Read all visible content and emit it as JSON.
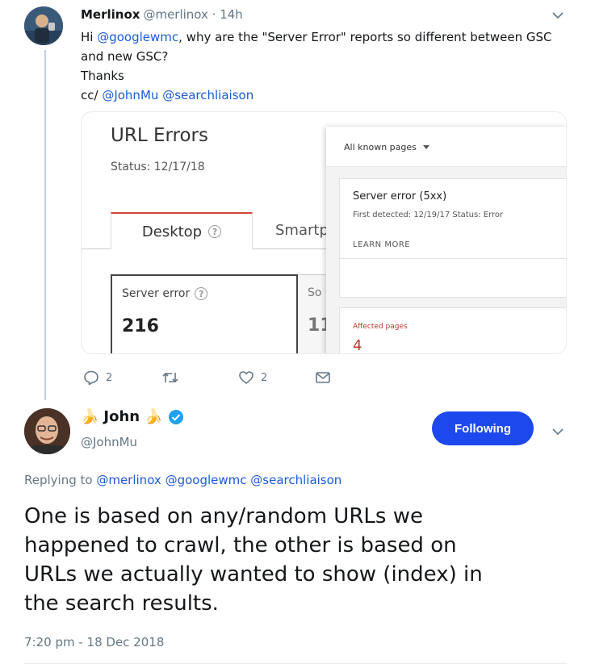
{
  "colors": {
    "link": "#1b5bd6",
    "button_bg": "#1d48ee",
    "muted": "#657786",
    "error_red": "#c0392b",
    "tab_accent": "#d0483a"
  },
  "tweet1": {
    "author_name": "Merlinox",
    "meta": "@merlinox · 14h",
    "text": {
      "greeting_prefix": "Hi ",
      "mention_googlewmc": "@googlewmc",
      "line1_rest": ", why are the \"Server Error\" reports so different between GSC",
      "line2": "and new GSC?",
      "line3": "Thanks",
      "cc_prefix": "cc/ ",
      "mention_johnmu": "@JohnMu",
      "mention_searchliaison": "@searchliaison"
    },
    "media": {
      "old_gsc": {
        "title": "URL Errors",
        "status": "Status: 12/17/18",
        "tab_desktop": "Desktop",
        "tab_smartphone": "Smartp",
        "server_error_label": "Server error",
        "server_error_value": "216",
        "second_label": "So",
        "second_value": "11"
      },
      "new_gsc": {
        "filter": "All known pages",
        "card_title": "Server error (5xx)",
        "card_sub": "First detected: 12/19/17   Status: Error",
        "learn_more": "LEARN MORE",
        "affected_label": "Affected pages",
        "affected_value": "4"
      }
    },
    "actions": {
      "reply_count": "2",
      "retweet_count": "",
      "like_count": "2"
    },
    "icons": [
      "reply-icon",
      "retweet-icon",
      "like-icon",
      "message-icon",
      "chevron-down-icon"
    ]
  },
  "tweet2": {
    "author_name": "John",
    "handle": "@JohnMu",
    "verified": true,
    "follow_label": "Following",
    "replying_prefix": "Replying to ",
    "replying_mentions": [
      "@merlinox",
      "@googlewmc",
      "@searchliaison"
    ],
    "text_lines": [
      "One is based on any/random URLs we",
      "happened to crawl, the other is based on",
      "URLs we actually wanted to show (index) in",
      "the search results."
    ],
    "timestamp": "7:20 pm - 18 Dec 2018"
  }
}
